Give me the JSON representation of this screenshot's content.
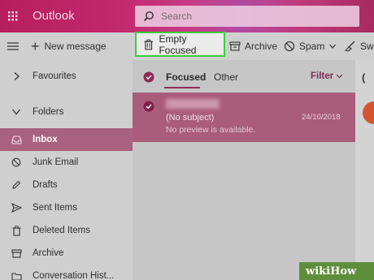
{
  "header": {
    "app_name": "Outlook",
    "search_placeholder": "Search"
  },
  "commands": {
    "new_message": "New message",
    "empty_focused": "Empty Focused",
    "archive": "Archive",
    "spam": "Spam",
    "sweep": "Swe"
  },
  "nav": {
    "favourites": "Favourites",
    "folders": "Folders",
    "items": [
      {
        "label": "Inbox",
        "icon": "inbox-icon",
        "selected": true
      },
      {
        "label": "Junk Email",
        "icon": "blocked-icon"
      },
      {
        "label": "Drafts",
        "icon": "pencil-icon"
      },
      {
        "label": "Sent Items",
        "icon": "send-icon"
      },
      {
        "label": "Deleted Items",
        "icon": "trash-icon"
      },
      {
        "label": "Archive",
        "icon": "archive-icon"
      },
      {
        "label": "Conversation Hist...",
        "icon": "folder-icon"
      }
    ]
  },
  "list": {
    "tab_focused": "Focused",
    "tab_other": "Other",
    "filter": "Filter",
    "messages": [
      {
        "subject": "(No subject)",
        "date": "24/10/2018",
        "preview": "No preview is available."
      }
    ]
  },
  "reading": {
    "partial": "("
  },
  "watermark": "wikiHow",
  "colors": {
    "accent": "#a8617e",
    "highlight_border": "#39d13c",
    "header": "#c2276a"
  }
}
